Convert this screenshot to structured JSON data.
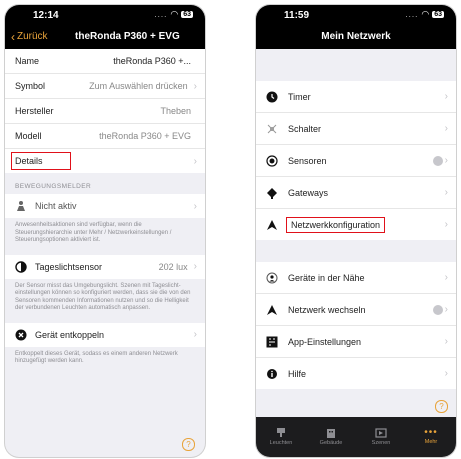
{
  "left": {
    "status": {
      "time": "12:14",
      "battery": "63"
    },
    "nav": {
      "back_label": "Zurück",
      "title": "theRonda P360 + EVG"
    },
    "info_rows": [
      {
        "label": "Name",
        "value": "theRonda P360 +..."
      },
      {
        "label": "Symbol",
        "value": "Zum Auswählen drücken"
      },
      {
        "label": "Hersteller",
        "value": "Theben"
      },
      {
        "label": "Modell",
        "value": "theRonda P360 + EVG"
      },
      {
        "label": "Details",
        "value": ""
      }
    ],
    "motion_section": {
      "header": "BEWEGUNGSMELDER",
      "row_label": "Nicht aktiv",
      "footer": "Anwesenheitsaktionen sind verfügbar, wenn die Steuerungshierarchie unter Mehr / Netzwerkeinstellungen / Steuerungsoptionen aktiviert ist."
    },
    "daylight": {
      "label": "Tageslichtsensor",
      "value": "202 lux",
      "footer": "Der Sensor misst das Umgebungslicht. Szenen mit Tageslicht-einstellungen können so konfiguriert werden, dass sie die von den Sensoren kommenden Informationen nutzen und so die Helligkeit der verbundenen Leuchten automatisch anpassen."
    },
    "decouple": {
      "label": "Gerät entkoppeln",
      "footer": "Entkoppelt dieses Gerät, sodass es einem anderen Netzwerk hinzugefügt werden kann."
    },
    "help_glyph": "?"
  },
  "right": {
    "status": {
      "time": "11:59",
      "battery": "63"
    },
    "nav": {
      "title": "Mein Netzwerk"
    },
    "group1": [
      {
        "label": "Timer",
        "icon": "clock-icon",
        "badge": false
      },
      {
        "label": "Schalter",
        "icon": "switch-icon",
        "badge": false
      },
      {
        "label": "Sensoren",
        "icon": "sensor-icon",
        "badge": true
      },
      {
        "label": "Gateways",
        "icon": "gateway-icon",
        "badge": false
      },
      {
        "label": "Netzwerkkonfiguration",
        "icon": "network-icon",
        "badge": false
      }
    ],
    "group2": [
      {
        "label": "Geräte in der Nähe",
        "icon": "nearby-icon",
        "badge": false
      },
      {
        "label": "Netzwerk wechseln",
        "icon": "network-switch-icon",
        "badge": true
      },
      {
        "label": "App-Einstellungen",
        "icon": "app-settings-icon",
        "badge": false
      },
      {
        "label": "Hilfe",
        "icon": "help-icon",
        "badge": false
      }
    ],
    "help_glyph": "?",
    "tabs": [
      {
        "label": "Leuchten",
        "icon": "lamp-icon",
        "active": false
      },
      {
        "label": "Gebäude",
        "icon": "building-icon",
        "active": false
      },
      {
        "label": "Szenen",
        "icon": "scene-icon",
        "active": false
      },
      {
        "label": "Mehr",
        "icon": "more-icon",
        "active": true
      }
    ]
  },
  "colors": {
    "accent": "#e8a33a",
    "highlight": "#e0111a",
    "background": "#efeff4"
  }
}
